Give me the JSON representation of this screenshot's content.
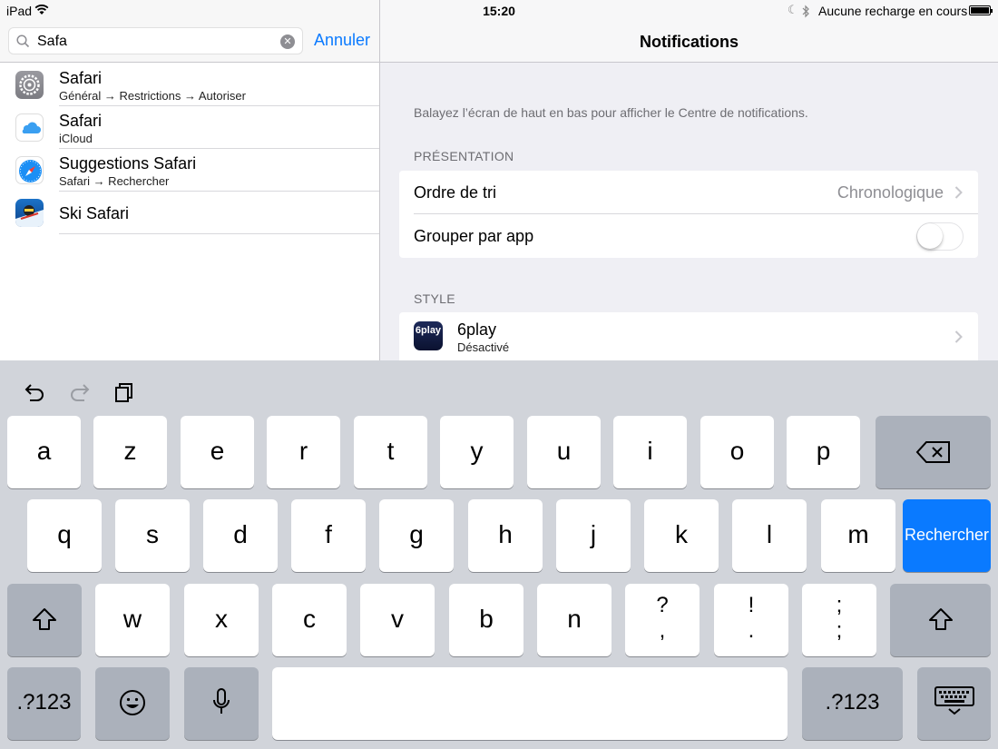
{
  "status_bar": {
    "device": "iPad",
    "time": "15:20",
    "charge_status": "Aucune recharge en cours"
  },
  "search": {
    "query": "Safa",
    "cancel_label": "Annuler"
  },
  "results": [
    {
      "title": "Safari",
      "subtitle": "Général → Restrictions → Autoriser",
      "icon": "settings-gear-icon"
    },
    {
      "title": "Safari",
      "subtitle": "iCloud",
      "icon": "icloud-icon"
    },
    {
      "title": "Suggestions Safari",
      "subtitle": "Safari → Rechercher",
      "icon": "safari-compass-icon"
    },
    {
      "title": "Ski Safari",
      "subtitle": "",
      "icon": "ski-safari-app-icon"
    }
  ],
  "settings": {
    "title": "Notifications",
    "hint": "Balayez l’écran de haut en bas pour afficher le Centre de notifications.",
    "section_presentation": "PRÉSENTATION",
    "sort_label": "Ordre de tri",
    "sort_value": "Chronologique",
    "group_label": "Grouper par app",
    "group_enabled": false,
    "section_style": "STYLE",
    "apps": [
      {
        "name": "6play",
        "status": "Désactivé",
        "icon_text": "6play"
      }
    ]
  },
  "keyboard": {
    "row1": [
      "a",
      "z",
      "e",
      "r",
      "t",
      "y",
      "u",
      "i",
      "o",
      "p"
    ],
    "row2": [
      "q",
      "s",
      "d",
      "f",
      "g",
      "h",
      "j",
      "k",
      "l",
      "m"
    ],
    "row3": [
      "w",
      "x",
      "c",
      "v",
      "b",
      "n"
    ],
    "row3_punct": [
      [
        "?",
        ","
      ],
      [
        "!",
        "."
      ],
      [
        ";",
        ";"
      ]
    ],
    "search_key": "Rechercher",
    "numbers_key": ".?123",
    "accent_color": "#0a7aff"
  }
}
